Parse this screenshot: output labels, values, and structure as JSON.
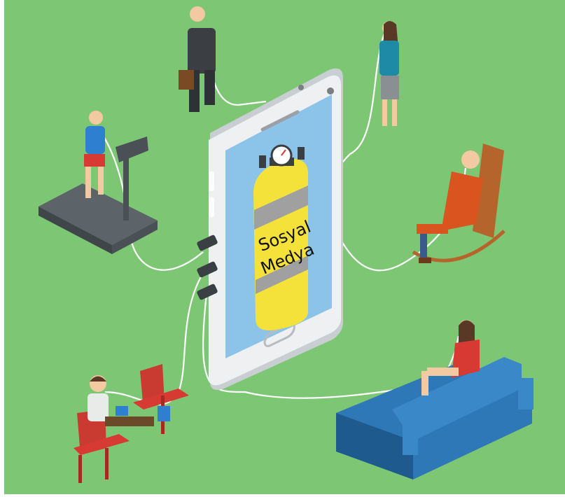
{
  "illustration": {
    "tank_label_line1": "Sosyal",
    "tank_label_line2": "Medya"
  },
  "colors": {
    "background": "#7dc774",
    "phone_body": "#e9ecef",
    "phone_screen": "#8cc3e8",
    "tank_yellow": "#f4e23a",
    "tank_gray": "#9a9a9a",
    "sofa_blue": "#2f78b8",
    "chair_red": "#d63a32",
    "rocking_chair_brown": "#b5652c",
    "treadmill_gray": "#555b60",
    "tube_white": "#ffffff"
  }
}
